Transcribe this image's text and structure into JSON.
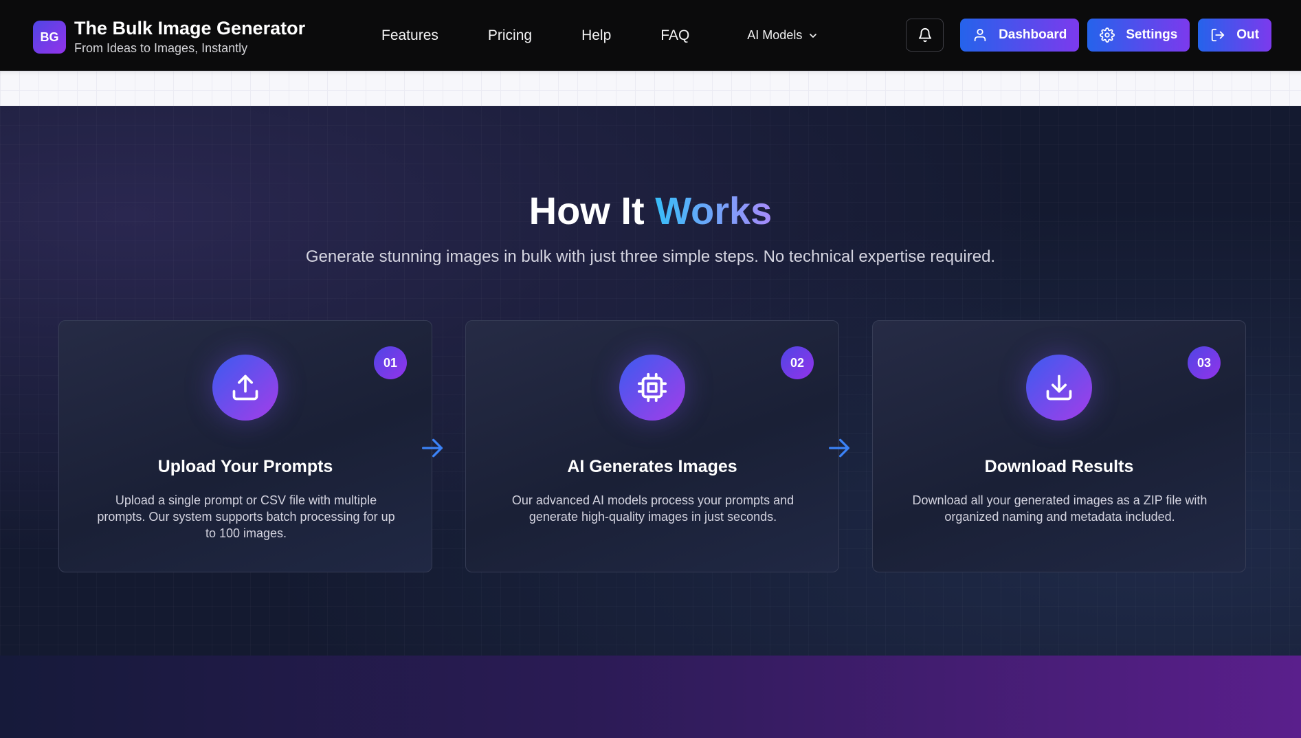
{
  "brand": {
    "logo_text": "BG",
    "title": "The Bulk Image Generator",
    "subtitle": "From Ideas to Images, Instantly"
  },
  "nav": {
    "links": [
      "Features",
      "Pricing",
      "Help",
      "FAQ"
    ],
    "models_label": "AI Models"
  },
  "actions": {
    "dashboard": "Dashboard",
    "settings": "Settings",
    "out": "Out"
  },
  "how": {
    "title_main": "How It ",
    "title_accent": "Works",
    "subtitle": "Generate stunning images in bulk with just three simple steps. No technical expertise required.",
    "steps": [
      {
        "number": "01",
        "icon": "upload-icon",
        "title": "Upload Your Prompts",
        "description": "Upload a single prompt or CSV file with multiple prompts. Our system supports batch processing for up to 100 images."
      },
      {
        "number": "02",
        "icon": "cpu-chip-icon",
        "title": "AI Generates Images",
        "description": "Our advanced AI models process your prompts and generate high-quality images in just seconds."
      },
      {
        "number": "03",
        "icon": "download-icon",
        "title": "Download Results",
        "description": "Download all your generated images as a ZIP file with organized naming and metadata included."
      }
    ]
  },
  "colors": {
    "nav_bg": "#0b0b0c",
    "accent_start": "#2563eb",
    "accent_end": "#7c3aed",
    "section_bg": "#141a30",
    "arrow": "#3b82f6"
  }
}
